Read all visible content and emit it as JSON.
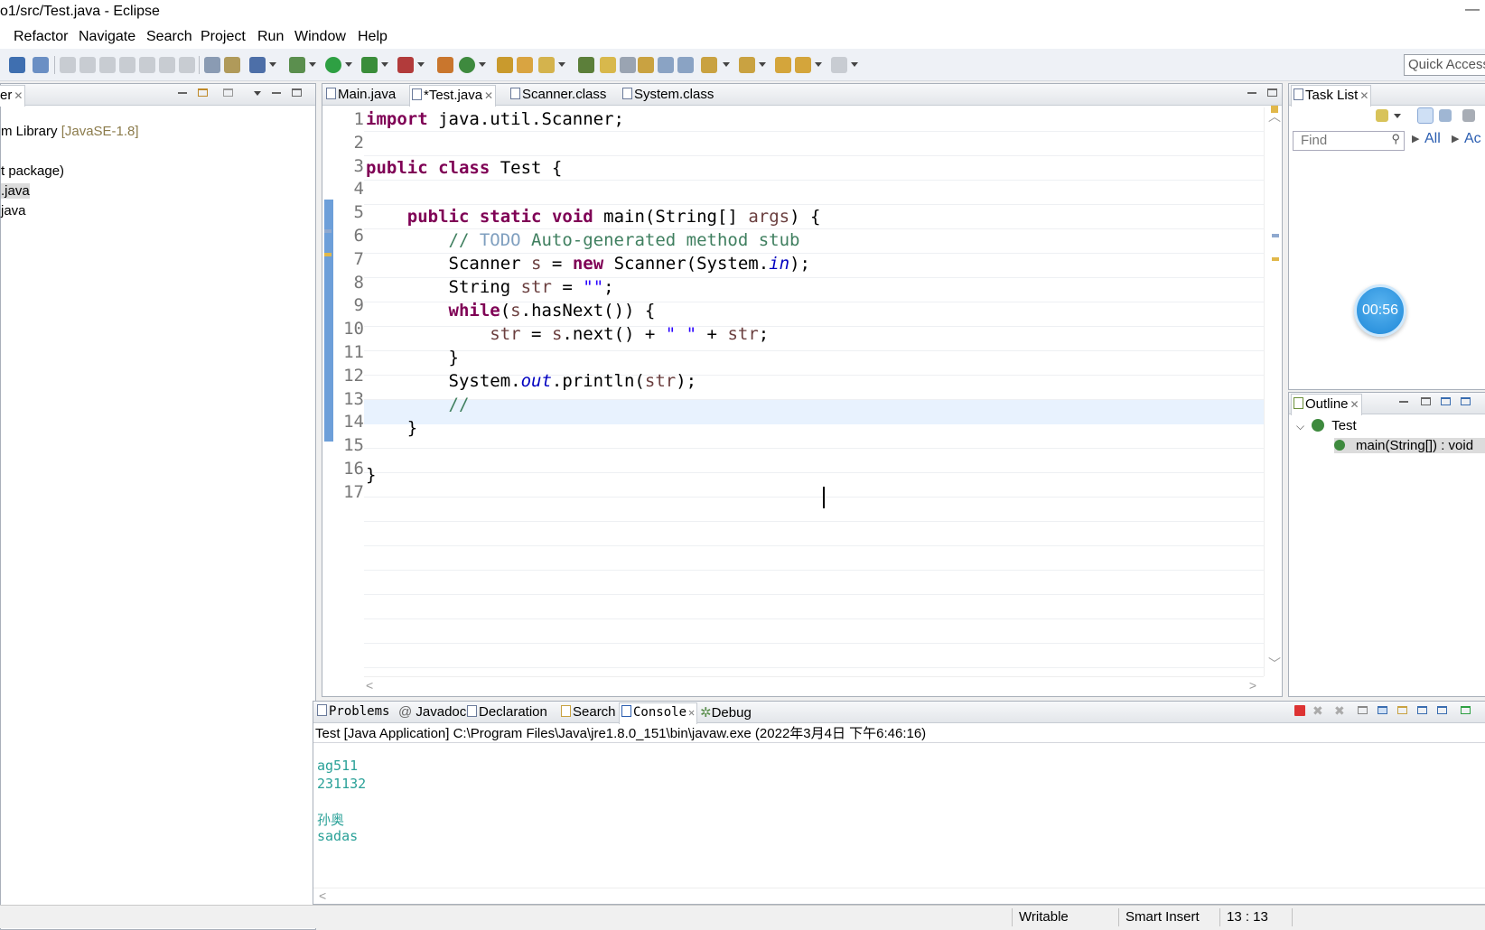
{
  "window": {
    "title": "o1/src/Test.java - Eclipse"
  },
  "menu": [
    "Refactor",
    "Navigate",
    "Search",
    "Project",
    "Run",
    "Window",
    "Help"
  ],
  "toolbar": {
    "quick_access": "Quick Access"
  },
  "explorer": {
    "tab_label": "er",
    "items": [
      {
        "text": "m Library ",
        "extra": "[JavaSE-1.8]"
      },
      {
        "text": "t package)"
      },
      {
        "text": ".java",
        "selected": true
      },
      {
        "text": "java"
      }
    ]
  },
  "editor": {
    "tabs": [
      "Main.java",
      "*Test.java",
      "Scanner.class",
      "System.class"
    ],
    "active_tab": 1,
    "line_numbers": [
      "1",
      "2",
      "3",
      "4",
      "5",
      "6",
      "7",
      "8",
      "9",
      "10",
      "11",
      "12",
      "13",
      "14",
      "15",
      "16",
      "17"
    ],
    "current_line": 13
  },
  "tasklist": {
    "tab_label": "Task List",
    "find_placeholder": "Find",
    "all_label": "All",
    "ac_label": "Ac",
    "timer": "00:56"
  },
  "outline": {
    "tab_label": "Outline",
    "class_name": "Test",
    "method": "main(String[]) : void"
  },
  "console": {
    "tabs": [
      "Problems",
      "Javadoc",
      "Declaration",
      "Search",
      "Console",
      "Debug"
    ],
    "header": "Test [Java Application] C:\\Program Files\\Java\\jre1.8.0_151\\bin\\javaw.exe (2022年3月4日 下午6:46:16)",
    "output": [
      "ag511",
      "231132",
      "",
      "孙奥",
      "sadas"
    ]
  },
  "status": {
    "writable": "Writable",
    "insert_mode": "Smart Insert",
    "position": "13 : 13"
  },
  "colors": {
    "keyword": "#7f0055",
    "comment": "#3f7f5f",
    "string": "#2a00ff",
    "field": "#0000c0",
    "console_output": "#2aa198",
    "current_line": "#e8f2fe"
  }
}
